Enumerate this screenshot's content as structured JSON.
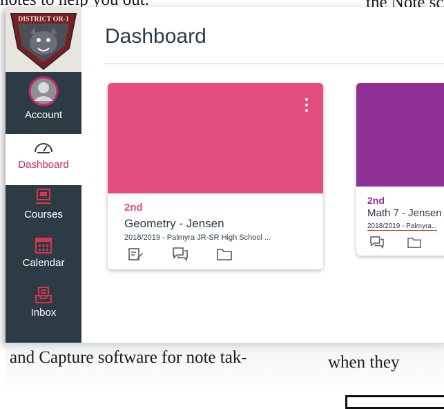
{
  "document": {
    "top_left_text": "notes to help you out.",
    "top_right_text": "the Note sc",
    "bottom_left_text": "and Capture software for note tak-",
    "bottom_right_text": "when they"
  },
  "logo": {
    "text": "DISTRICT OR-1"
  },
  "sidebar": {
    "items": [
      {
        "label": "Account",
        "icon": "account-icon"
      },
      {
        "label": "Dashboard",
        "icon": "dashboard-icon",
        "active": true
      },
      {
        "label": "Courses",
        "icon": "courses-icon"
      },
      {
        "label": "Calendar",
        "icon": "calendar-icon"
      },
      {
        "label": "Inbox",
        "icon": "inbox-icon"
      }
    ]
  },
  "main": {
    "title": "Dashboard",
    "cards": [
      {
        "term": "2nd",
        "name": "Geometry - Jensen",
        "subtitle": "2018/2019 - Palmyra JR-SR High School ...",
        "color": "#e34d80",
        "icons": [
          "assignments-icon",
          "discussions-icon",
          "files-icon"
        ]
      },
      {
        "term": "2nd",
        "name": "Math 7 - Jensen",
        "subtitle": "2018/2019 - Palmyra...",
        "color": "#8e3096",
        "icons": [
          "discussions-icon",
          "files-icon"
        ]
      }
    ]
  },
  "colors": {
    "sidebar": "#2d3b45",
    "accent": "#d3265c"
  }
}
